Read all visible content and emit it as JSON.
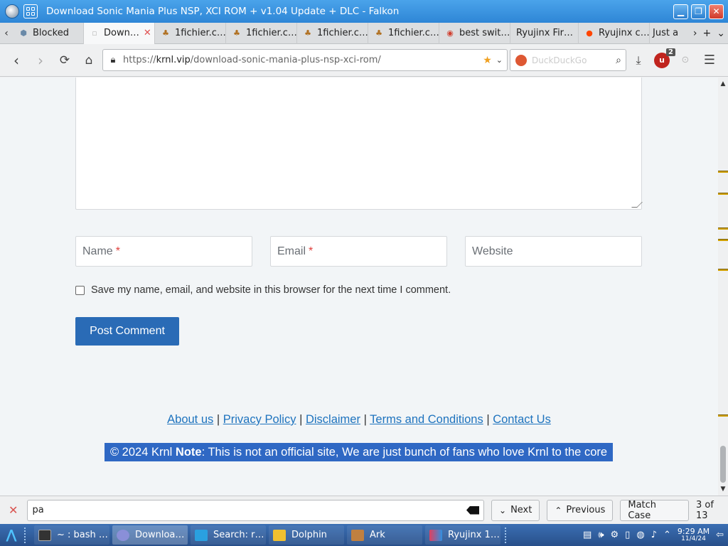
{
  "window": {
    "title": "Download Sonic Mania Plus NSP, XCI ROM + v1.04 Update + DLC - Falkon"
  },
  "tabs": [
    {
      "label": "Blocked",
      "icon": "shield-icon",
      "active": false
    },
    {
      "label": "Down…",
      "icon": "page-icon",
      "active": true
    },
    {
      "label": "1fichier.c…",
      "icon": "squirrel-icon",
      "active": false
    },
    {
      "label": "1fichier.c…",
      "icon": "squirrel-icon",
      "active": false
    },
    {
      "label": "1fichier.c…",
      "icon": "squirrel-icon",
      "active": false
    },
    {
      "label": "1fichier.c…",
      "icon": "squirrel-icon",
      "active": false
    },
    {
      "label": "best swit…",
      "icon": "circle-red-icon",
      "active": false
    },
    {
      "label": "Ryujinx Fir…",
      "icon": "none",
      "active": false
    },
    {
      "label": "Ryujinx c…",
      "icon": "reddit-icon",
      "active": false
    },
    {
      "label": "Just a",
      "icon": "none",
      "active": false
    }
  ],
  "nav": {
    "url_prefix": "https://",
    "url_domain": "krnl.vip",
    "url_path": "/download-sonic-mania-plus-nsp-xci-rom/",
    "search_placeholder": "DuckDuckGo",
    "download_badge": "2"
  },
  "form": {
    "name_placeholder": "Name",
    "email_placeholder": "Email",
    "website_placeholder": "Website",
    "required_mark": "*",
    "consent_label": "Save my name, email, and website in this browser for the next time I comment.",
    "submit_label": "Post Comment"
  },
  "footer": {
    "links": [
      "About us",
      "Privacy Policy",
      "Disclaimer",
      "Terms and Conditions",
      "Contact Us"
    ],
    "separator": "|",
    "copyright_prefix": "© 2024 Krnl ",
    "note_label": "Note",
    "note_text": ": This is not an official site, We are just bunch of fans who love Krnl to the core"
  },
  "findbar": {
    "query": "pa",
    "next_label": "Next",
    "previous_label": "Previous",
    "match_case_label": "Match Case",
    "count": "3 of 13"
  },
  "taskbar": {
    "tasks": [
      {
        "label": "~ : bash …",
        "color": "#333"
      },
      {
        "label": "Downloa…",
        "color": "#8a8fd8",
        "active": true
      },
      {
        "label": "Search: r…",
        "color": "#2aa0e0"
      },
      {
        "label": "Dolphin",
        "color": "#f0c030"
      },
      {
        "label": "Ark",
        "color": "#c08040"
      },
      {
        "label": "Ryujinx 1…",
        "color": "#e04060"
      }
    ],
    "time": "9:29 AM",
    "date": "11/4/24"
  },
  "colors": {
    "accent": "#2a6bb6",
    "link": "#1e73be",
    "titlebar": "#2e86d6",
    "selection": "#2f68c4"
  }
}
